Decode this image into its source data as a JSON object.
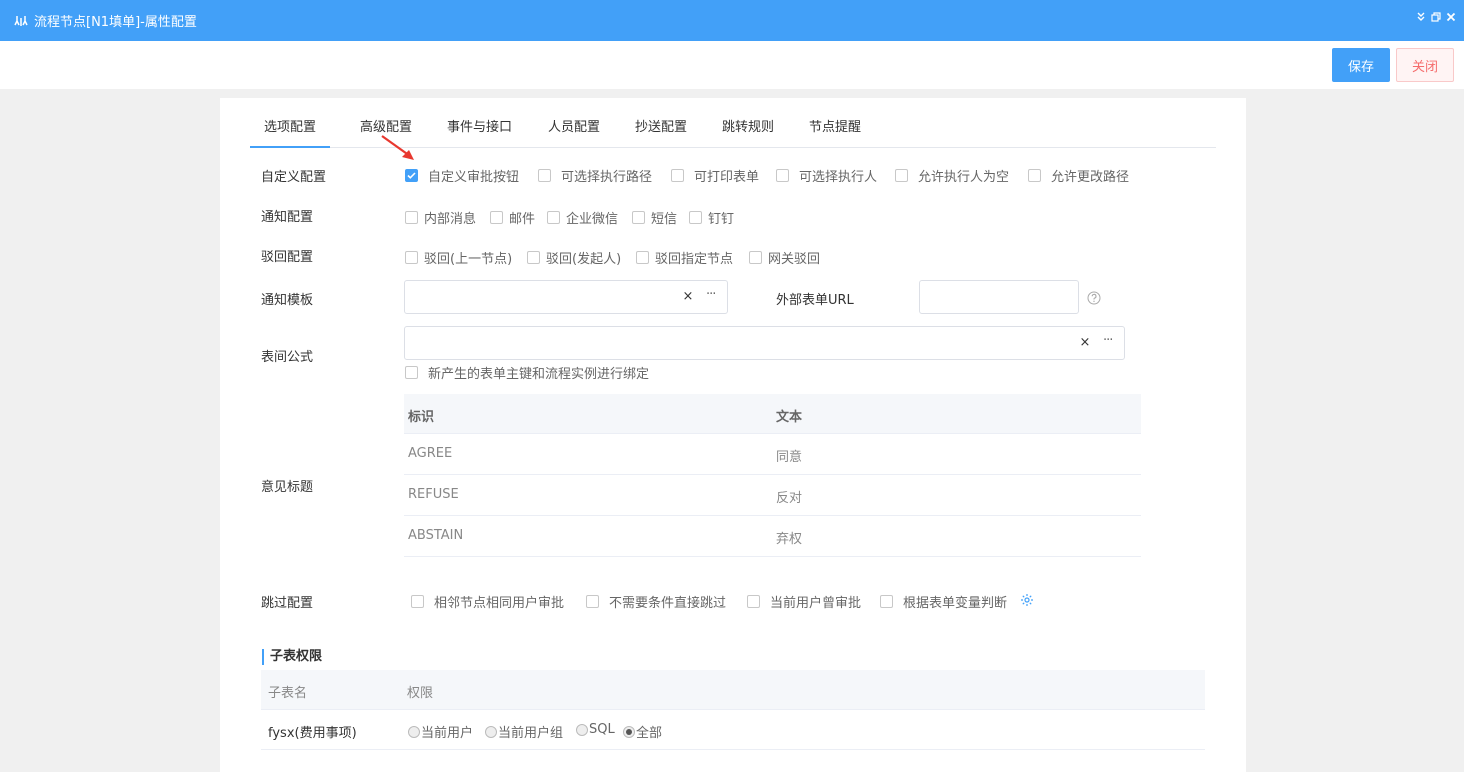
{
  "window": {
    "title": "流程节点[N1填单]-属性配置",
    "app_icon": "flow-icon",
    "controls": [
      "collapse-icon",
      "restore-icon",
      "close-icon"
    ]
  },
  "toolbar": {
    "save_label": "保存",
    "close_label": "关闭"
  },
  "tabs": [
    {
      "label": "选项配置",
      "active": true
    },
    {
      "label": "高级配置"
    },
    {
      "label": "事件与接口"
    },
    {
      "label": "人员配置"
    },
    {
      "label": "抄送配置"
    },
    {
      "label": "跳转规则"
    },
    {
      "label": "节点提醒"
    }
  ],
  "custom_config": {
    "label": "自定义配置",
    "options": [
      {
        "label": "自定义审批按钮",
        "checked": true
      },
      {
        "label": "可选择执行路径",
        "checked": false
      },
      {
        "label": "可打印表单",
        "checked": false
      },
      {
        "label": "可选择执行人",
        "checked": false
      },
      {
        "label": "允许执行人为空",
        "checked": false
      },
      {
        "label": "允许更改路径",
        "checked": false
      }
    ]
  },
  "notify_config": {
    "label": "通知配置",
    "options": [
      {
        "label": "内部消息",
        "checked": false
      },
      {
        "label": "邮件",
        "checked": false
      },
      {
        "label": "企业微信",
        "checked": false
      },
      {
        "label": "短信",
        "checked": false
      },
      {
        "label": "钉钉",
        "checked": false
      }
    ]
  },
  "reject_config": {
    "label": "驳回配置",
    "options": [
      {
        "label": "驳回(上一节点)",
        "checked": false
      },
      {
        "label": "驳回(发起人)",
        "checked": false
      },
      {
        "label": "驳回指定节点",
        "checked": false
      },
      {
        "label": "网关驳回",
        "checked": false
      }
    ]
  },
  "notify_template": {
    "label": "通知模板",
    "value": "",
    "clear": "×",
    "more": "···"
  },
  "external_url": {
    "label": "外部表单URL",
    "value": "",
    "help_icon": "question-circle-icon"
  },
  "formula": {
    "label": "表间公式",
    "value": "",
    "clear": "×",
    "more": "···",
    "bind_option": {
      "label": "新产生的表单主键和流程实例进行绑定",
      "checked": false
    }
  },
  "opinion": {
    "label": "意见标题",
    "headers": [
      "标识",
      "文本"
    ],
    "rows": [
      {
        "key": "AGREE",
        "text": "同意"
      },
      {
        "key": "REFUSE",
        "text": "反对"
      },
      {
        "key": "ABSTAIN",
        "text": "弃权"
      }
    ]
  },
  "skip_config": {
    "label": "跳过配置",
    "options": [
      {
        "label": "相邻节点相同用户审批",
        "checked": false
      },
      {
        "label": "不需要条件直接跳过",
        "checked": false
      },
      {
        "label": "当前用户曾审批",
        "checked": false
      },
      {
        "label": "根据表单变量判断",
        "checked": false
      }
    ],
    "settings_icon": "gear-icon"
  },
  "subtable": {
    "title": "子表权限",
    "headers": [
      "子表名",
      "权限"
    ],
    "rows": [
      {
        "name": "fysx(费用事项)",
        "options": [
          {
            "label": "当前用户",
            "selected": false
          },
          {
            "label": "当前用户组",
            "selected": false
          },
          {
            "label": "SQL",
            "selected": false
          },
          {
            "label": "全部",
            "selected": true
          }
        ]
      }
    ]
  },
  "annotation": {
    "arrow_color": "#e8382f"
  },
  "colors": {
    "accent": "#42a0f8",
    "danger": "#f56c6c"
  }
}
